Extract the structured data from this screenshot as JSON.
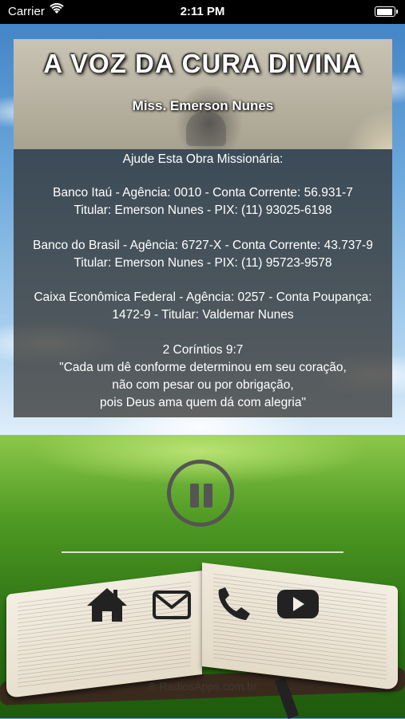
{
  "status_bar": {
    "carrier": "Carrier",
    "time": "2:11 PM"
  },
  "header": {
    "title": "A VOZ DA CURA DIVINA",
    "subtitle": "Miss. Emerson Nunes"
  },
  "info": {
    "intro": "Ajude Esta Obra Missionária:",
    "bank1_line1": "Banco Itaú  - Agência: 0010  - Conta Corrente: 56.931-7",
    "bank1_line2": "Titular: Emerson Nunes - PIX: (11) 93025-6198",
    "bank2_line1": "Banco do Brasil - Agência: 6727-X - Conta Corrente: 43.737-9",
    "bank2_line2": "Titular: Emerson Nunes - PIX: (11) 95723-9578",
    "bank3_line1": "Caixa Econômica Federal - Agência: 0257 - Conta Poupança:",
    "bank3_line2": "1472-9 - Titular: Valdemar Nunes",
    "verse_ref": "2 Coríntios 9:7",
    "verse_line1": "\"Cada um dê conforme determinou em seu coração,",
    "verse_line2": "não com pesar ou por obrigação,",
    "verse_line3": "pois Deus ama quem dá com alegria\""
  },
  "player": {
    "state_icon": "pause-icon"
  },
  "nav_icons": [
    "home-icon",
    "mail-icon",
    "phone-icon",
    "youtube-icon"
  ],
  "footer": {
    "copyright": "® RadiosApps.com.br"
  },
  "colors": {
    "panel_bg": "#2d2a26",
    "player_gray": "#555555",
    "icon_dark": "#222222"
  }
}
